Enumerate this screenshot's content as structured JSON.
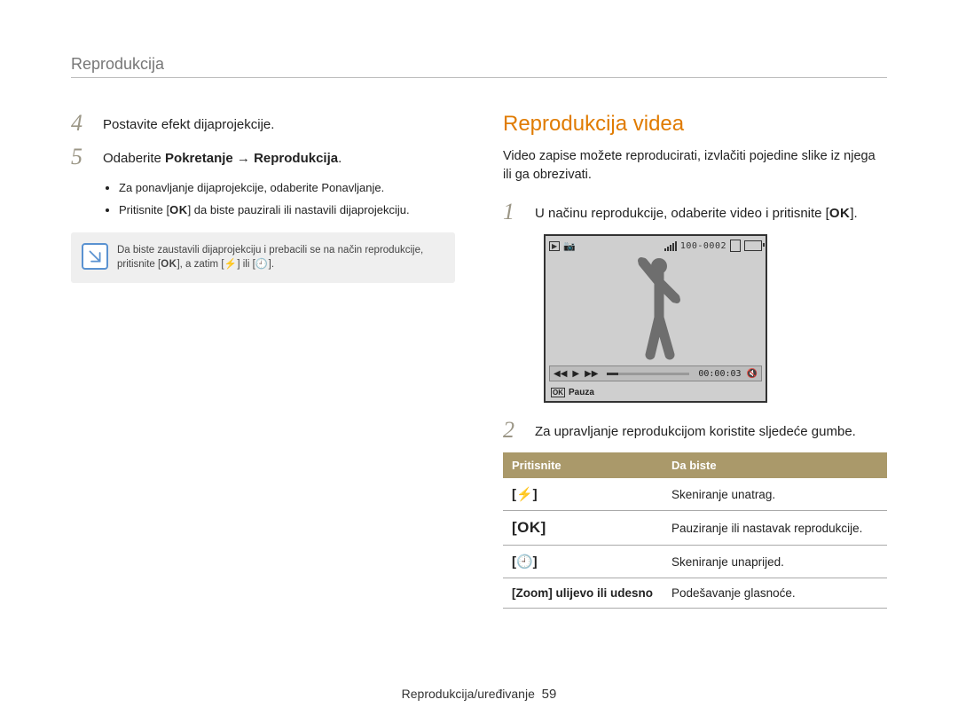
{
  "header": {
    "section_title": "Reprodukcija"
  },
  "left": {
    "step4_num": "4",
    "step4_text": "Postavite efekt dijaprojekcije.",
    "step5_num": "5",
    "step5_prefix": "Odaberite ",
    "step5_bold": "Pokretanje → Reprodukcija",
    "step5_suffix": ".",
    "sub1_pre": "Za ponavljanje dijaprojekcije, odaberite ",
    "sub1_bold": "Ponavljanje",
    "sub1_suf": ".",
    "sub2_pre": "Pritisnite [",
    "sub2_key": "OK",
    "sub2_suf": "] da biste pauzirali ili nastavili dijaprojekciju.",
    "note_line1_pre": "Da biste zaustavili dijaprojekciju i prebacili se na način reprodukcije, pritisnite [",
    "note_key1": "OK",
    "note_line1_mid": "], a zatim [",
    "note_key2": "⚡",
    "note_line1_mid2": "] ili [",
    "note_key3": "🕘",
    "note_line1_end": "]."
  },
  "right": {
    "title": "Reprodukcija videa",
    "desc": "Video zapise možete reproducirati, izvlačiti pojedine slike iz njega ili ga obrezivati.",
    "step1_num": "1",
    "step1_pre": "U načinu reprodukcije, odaberite video i pritisnite [",
    "step1_key": "OK",
    "step1_suf": "].",
    "screen": {
      "folder_file": "100-0002",
      "time": "00:00:03",
      "pause_label": "Pauza",
      "ok": "OK"
    },
    "step2_num": "2",
    "step2_text": "Za upravljanje reprodukcijom koristite sljedeće gumbe.",
    "table": {
      "h1": "Pritisnite",
      "h2": "Da biste",
      "rows": [
        {
          "k": "[⚡]",
          "v": "Skeniranje unatrag."
        },
        {
          "k": "[OK]",
          "v": "Pauziranje ili nastavak reprodukcije."
        },
        {
          "k": "[🕘]",
          "v": "Skeniranje unaprijed."
        },
        {
          "k": "[Zoom] ulijevo ili udesno",
          "v": "Podešavanje glasnoće."
        }
      ]
    }
  },
  "footer": {
    "path": "Reprodukcija/uređivanje",
    "page": "59"
  }
}
